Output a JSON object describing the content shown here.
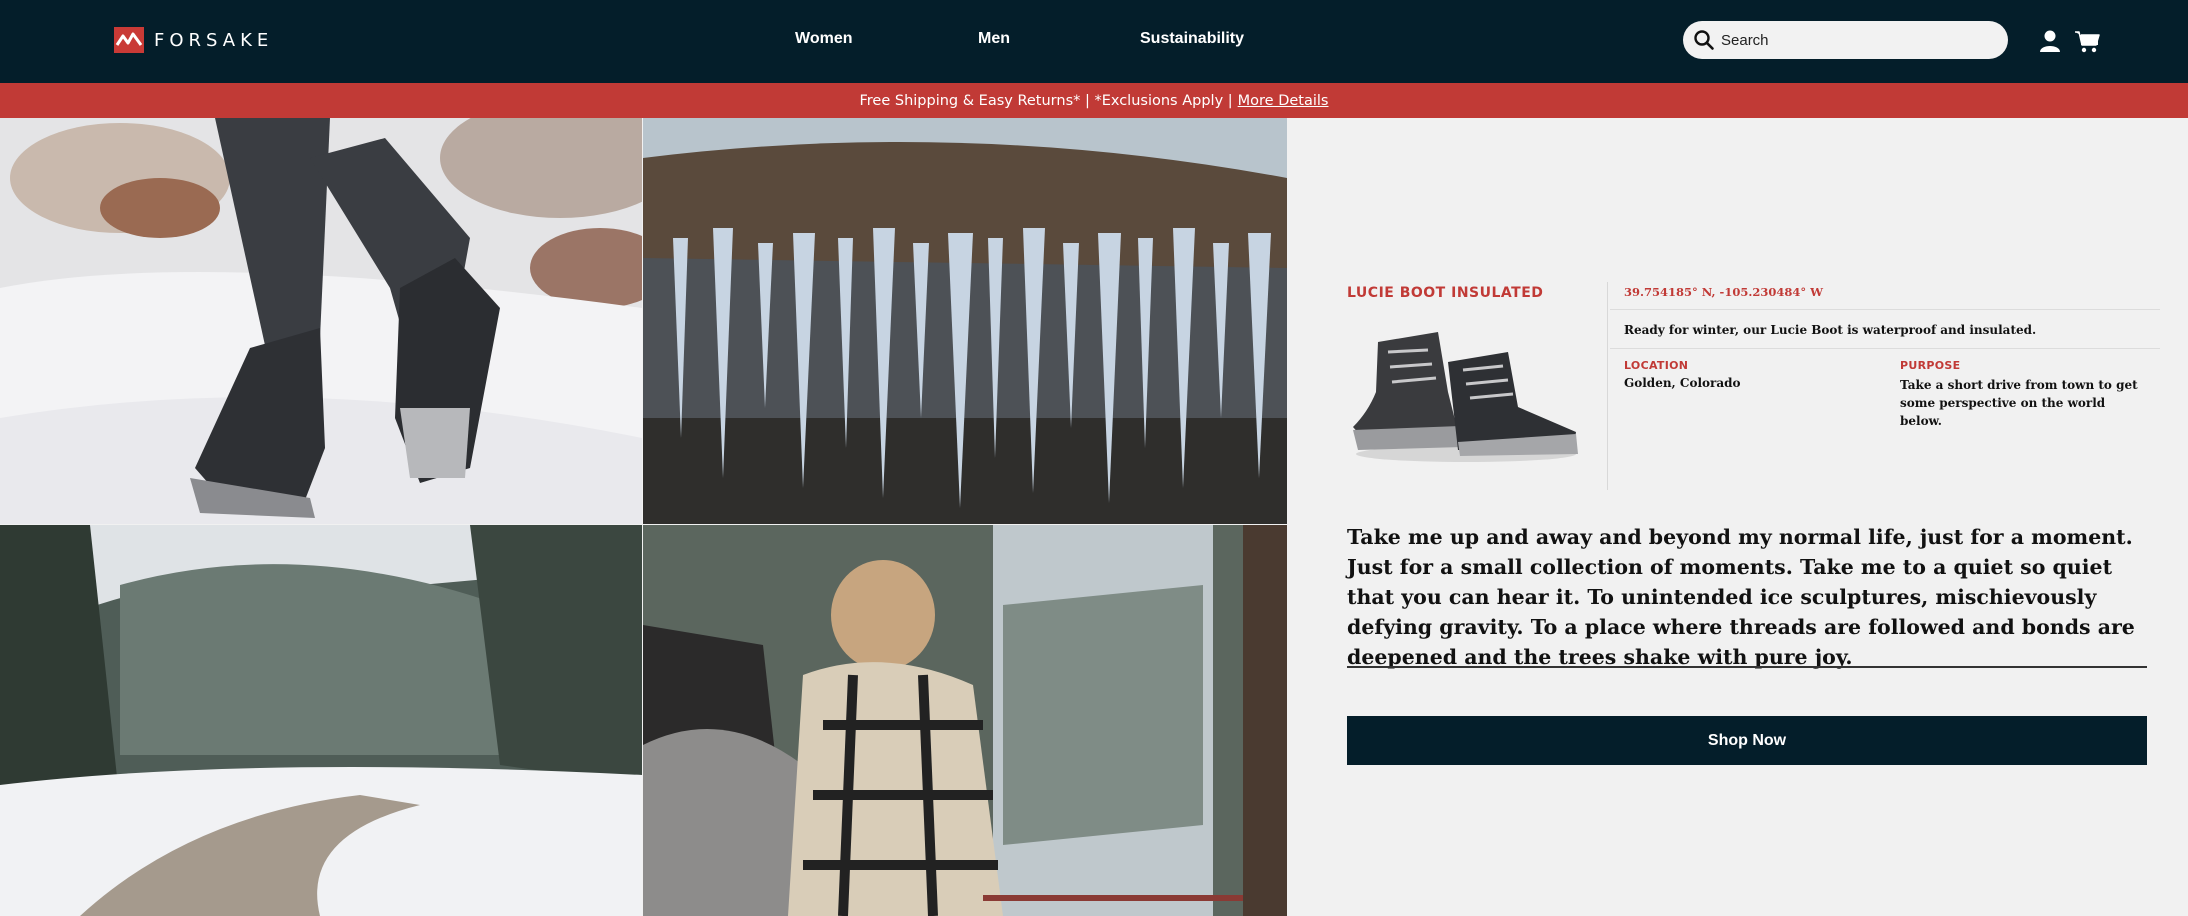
{
  "header": {
    "logo_text": "FORSAKE",
    "nav": [
      "Women",
      "Men",
      "Sustainability"
    ],
    "search_placeholder": "Search"
  },
  "promo": {
    "text": "Free Shipping & Easy Returns* | *Exclusions Apply |",
    "link": "More Details"
  },
  "product": {
    "name": "LUCIE BOOT INSULATED",
    "coordinates": "39.754185° N, -105.230484° W",
    "description": "Ready for winter, our Lucie Boot is waterproof and insulated.",
    "location_label": "LOCATION",
    "location_value": "Golden, Colorado",
    "purpose_label": "PURPOSE",
    "purpose_value": "Take a short drive from town to get some perspective on the world below."
  },
  "story": "Take me up and away and beyond my normal life, just for a moment. Just for a small collection of moments. Take me to a quiet so quiet that you can hear it. To unintended ice sculptures, mischievously defying gravity. To a place where threads are followed and bonds are deepened and the trees shake with pure joy.",
  "cta": {
    "label": "Shop Now"
  },
  "colors": {
    "navy": "#041e2a",
    "brand_red": "#c13a36",
    "panel_bg": "#f1f1f1"
  },
  "icons": [
    "search-icon",
    "user-icon",
    "cart-icon"
  ]
}
